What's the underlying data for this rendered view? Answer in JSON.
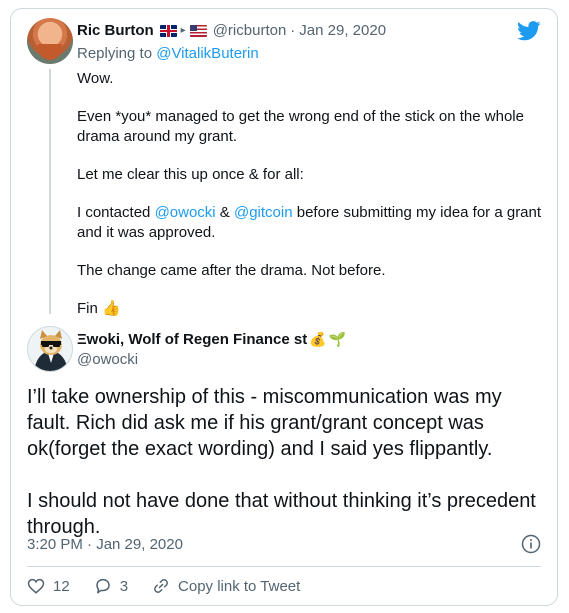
{
  "parent_tweet": {
    "author_name": "Ric Burton",
    "author_handle": "@ricburton",
    "date": "Jan 29, 2020",
    "separator": "·",
    "flag_arrow": "▸",
    "replying_prefix": "Replying to",
    "replying_handle": "@VitalikButerin",
    "paragraphs": {
      "p1": "Wow.",
      "p2": "Even *you* managed to get the wrong end of the stick on the whole drama around my grant.",
      "p3": "Let me clear this up once & for all:",
      "p4_a": "I contacted ",
      "p4_mention1": "@owocki",
      "p4_b": " & ",
      "p4_mention2": "@gitcoin",
      "p4_c": " before submitting my idea for a grant and it was approved.",
      "p5": "The change came after the drama. Not before.",
      "p6": "Fin",
      "p6_emoji": "👍"
    }
  },
  "main_tweet": {
    "author_name": "Ξwoki, Wolf of Regen Finance st",
    "name_emoji_1": "💰",
    "name_emoji_2": "🌱",
    "author_handle": "@owocki",
    "paragraphs": {
      "p1": "I’ll take ownership of this - miscommunication was my fault. Rich did ask me if his grant/grant concept was ok(forget the exact wording) and I said yes flippantly.",
      "p2": "I should not have done that without thinking it’s precedent through."
    },
    "timestamp": "3:20 PM · Jan 29, 2020"
  },
  "actions": {
    "like_count": "12",
    "reply_count": "3",
    "copy_link_label": "Copy link to Tweet"
  },
  "colors": {
    "brand": "#1d9bf0",
    "text_primary": "#0f1419",
    "text_secondary": "#536471",
    "border": "#cfd9de"
  }
}
